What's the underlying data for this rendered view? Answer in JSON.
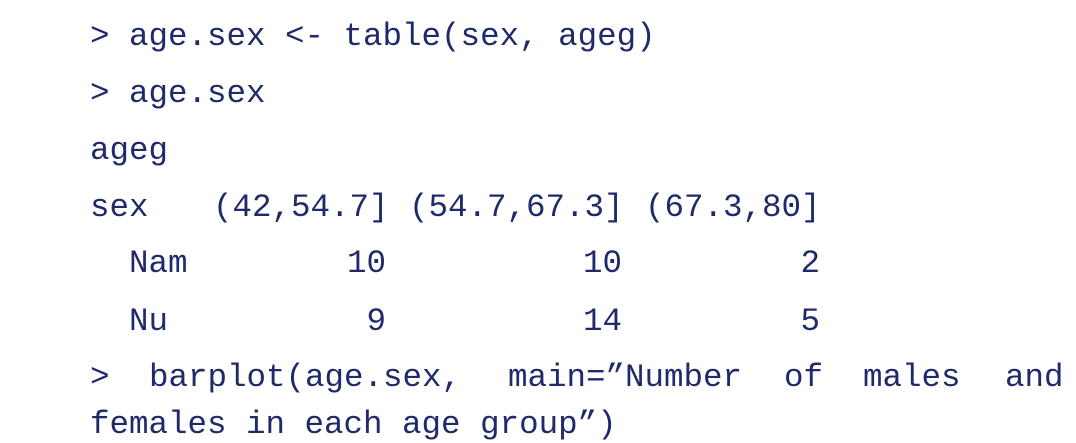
{
  "console": {
    "lines": {
      "cmd1": "> age.sex <- table(sex, ageg)",
      "cmd2": "> age.sex",
      "colvar": "ageg",
      "rowvar": "sex"
    },
    "table": {
      "col_headers": [
        "(42,54.7]",
        "(54.7,67.3]",
        "(67.3,80]"
      ],
      "rows": [
        {
          "label": "Nam",
          "values": [
            "10",
            "10",
            "2"
          ]
        },
        {
          "label": "Nu",
          "values": [
            "9",
            "14",
            "5"
          ]
        }
      ]
    },
    "barplot_cmd": {
      "prompt": ">",
      "line1_tokens": [
        "barplot(age.sex,",
        "main=”Number",
        "of",
        "males",
        "and"
      ],
      "line2": "females in each age group”)"
    }
  }
}
